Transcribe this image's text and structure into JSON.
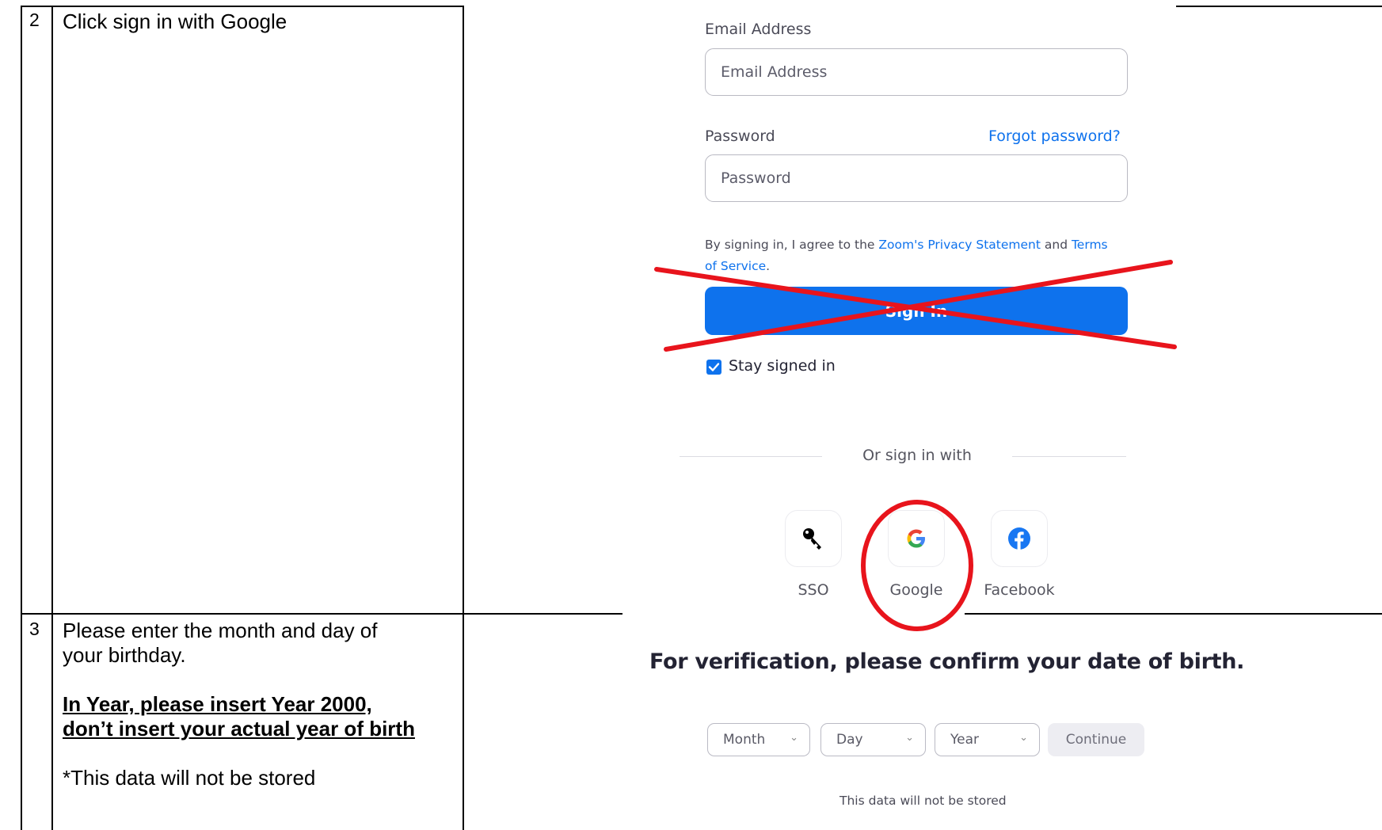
{
  "rows": [
    {
      "step": "2",
      "instruction": "Click sign in with Google"
    },
    {
      "step": "3",
      "instruction_line1": "Please enter the month and day of",
      "instruction_line2": "your birthday.",
      "emphasis_line1": "In Year, please insert Year 2000,",
      "emphasis_line2": "don’t insert your actual year of birth",
      "note": "*This data will not be stored"
    }
  ],
  "signin": {
    "email_label": "Email Address",
    "email_placeholder": "Email Address",
    "password_label": "Password",
    "forgot_password": "Forgot password?",
    "password_placeholder": "Password",
    "agree_prefix": "By signing in, I agree to the ",
    "privacy_link": "Zoom's Privacy Statement",
    "agree_and": " and ",
    "terms_link_a": "Terms",
    "terms_link_b": "of Service",
    "agree_suffix": ".",
    "sign_in_button": "Sign In",
    "stay_signed_in": "Stay signed in",
    "stay_signed_in_checked": true,
    "or_sign_in_with": "Or sign in with",
    "sso_label": "SSO",
    "google_label": "Google",
    "facebook_label": "Facebook",
    "button_color": "#0e72ed",
    "annotation_color": "#e8141c"
  },
  "dob": {
    "heading": "For verification, please confirm your date of birth.",
    "month_placeholder": "Month",
    "day_placeholder": "Day",
    "year_placeholder": "Year",
    "continue_label": "Continue",
    "footnote": "This data will not be stored"
  }
}
